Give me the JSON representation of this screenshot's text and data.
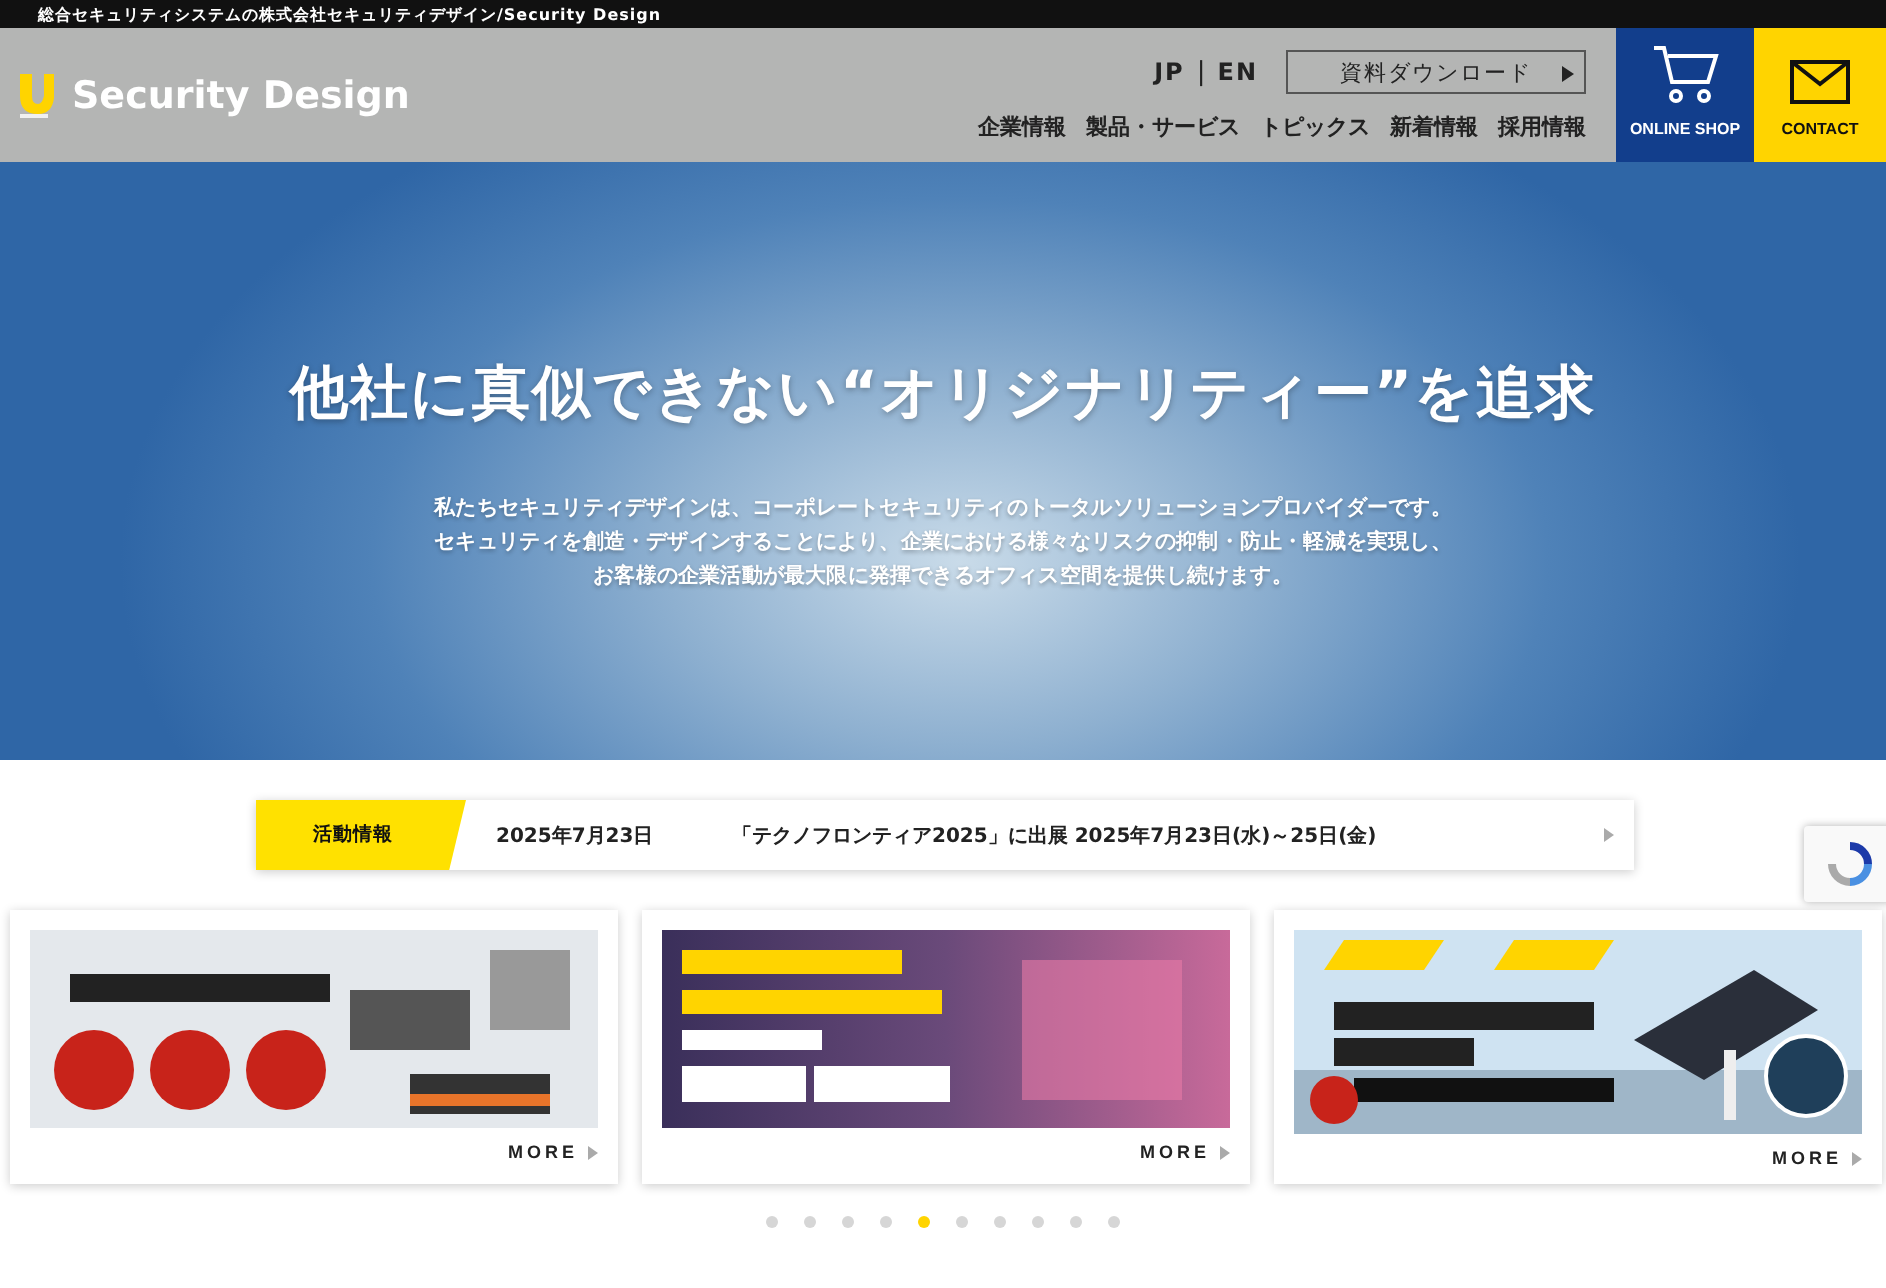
{
  "top_bar": {
    "text": "総合セキュリティシステムの株式会社セキュリティデザイン/Security Design"
  },
  "header": {
    "logo_text": "Security Design",
    "languages": [
      {
        "label": "JP"
      },
      {
        "label": "EN"
      }
    ],
    "language_separator": "|",
    "download_button": "資料ダウンロード",
    "nav": [
      "企業情報",
      "製品・サービス",
      "トピックス",
      "新着情報",
      "採用情報"
    ],
    "online_shop": "ONLINE SHOP",
    "contact": "CONTACT"
  },
  "hero": {
    "title": "他社に真似できない“オリジナリティー”を追求",
    "lines": [
      "私たちセキュリティデザインは、コーポレートセキュリティのトータルソリューションプロバイダーです。",
      "セキュリティを創造・デザインすることにより、企業における様々なリスクの抑制・防止・軽減を実現し、",
      "お客様の企業活動が最大限に発揮できるオフィス空間を提供し続けます。"
    ]
  },
  "news": {
    "tag": "活動情報",
    "date": "2025年7月23日",
    "headline": "「テクノフロンティア2025」に出展 2025年7月23日(水)～25日(金)"
  },
  "cards": [
    {
      "kind": "robots",
      "more": "MORE"
    },
    {
      "kind": "vision",
      "more": "MORE"
    },
    {
      "kind": "solar",
      "more": "MORE"
    }
  ],
  "carousel_dots": [
    {
      "selected": false
    },
    {
      "selected": false
    },
    {
      "selected": false
    },
    {
      "selected": false
    },
    {
      "selected": true
    },
    {
      "selected": false
    },
    {
      "selected": false
    },
    {
      "selected": false
    },
    {
      "selected": false
    },
    {
      "selected": false
    }
  ]
}
